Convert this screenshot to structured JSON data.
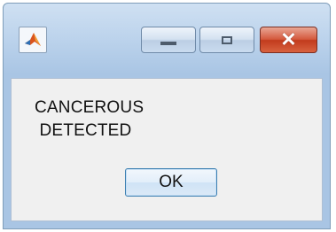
{
  "window": {
    "title": "",
    "app_icon": "matlab-icon",
    "controls": {
      "minimize_icon": "minimize-icon",
      "maximize_icon": "maximize-icon",
      "close_icon": "close-icon",
      "close_glyph": "✕"
    }
  },
  "dialog": {
    "message_lines": [
      "CANCEROUS",
      " DETECTED"
    ],
    "ok_label": "OK"
  },
  "colors": {
    "frame": "#bcd3ec",
    "client": "#f0f0f0",
    "close_button": "#c23b1d",
    "ok_border": "#3c7fb1"
  }
}
